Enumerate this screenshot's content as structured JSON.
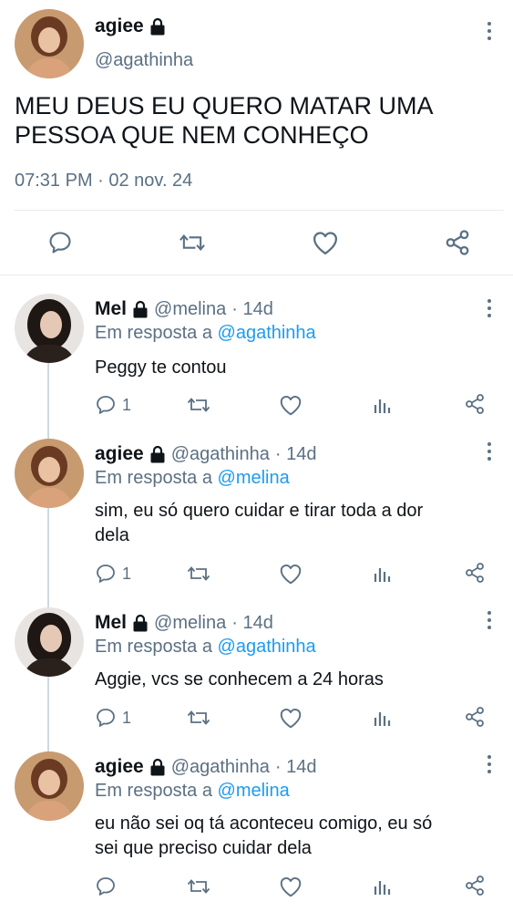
{
  "main_tweet": {
    "display_name": "agiee",
    "handle": "@agathinha",
    "text_line1": "MEU DEUS EU QUERO MATAR UMA",
    "text_line2": "PESSOA QUE NEM CONHEÇO",
    "timestamp": "07:31 PM · 02 nov. 24"
  },
  "replies": [
    {
      "display_name": "Mel",
      "handle": "@melina",
      "time": "· 14d",
      "reply_prefix": "Em resposta a",
      "reply_to": "@agathinha",
      "text_line1": "Peggy te contou",
      "text_line2": "",
      "reply_count": "1",
      "avatar": "dark-hair"
    },
    {
      "display_name": "agiee",
      "handle": "@agathinha",
      "time": "· 14d",
      "reply_prefix": "Em resposta a",
      "reply_to": "@melina",
      "text_line1": "sim, eu só quero cuidar e tirar toda a dor",
      "text_line2": "dela",
      "reply_count": "1",
      "avatar": "warm"
    },
    {
      "display_name": "Mel",
      "handle": "@melina",
      "time": "· 14d",
      "reply_prefix": "Em resposta a",
      "reply_to": "@agathinha",
      "text_line1": "Aggie, vcs se conhecem a 24 horas",
      "text_line2": "",
      "reply_count": "1",
      "avatar": "dark-hair"
    },
    {
      "display_name": "agiee",
      "handle": "@agathinha",
      "time": "· 14d",
      "reply_prefix": "Em resposta a",
      "reply_to": "@melina",
      "text_line1": "eu não sei oq tá aconteceu comigo, eu só",
      "text_line2": "sei que preciso cuidar dela",
      "reply_count": "",
      "avatar": "warm"
    }
  ],
  "icons": [
    "lock-icon",
    "more-icon",
    "reply-icon",
    "retweet-icon",
    "like-icon",
    "share-icon",
    "analytics-icon"
  ],
  "colors": {
    "link": "#1d9bf0",
    "secondary_text": "#5b7083",
    "divider": "#e6ecf0"
  }
}
